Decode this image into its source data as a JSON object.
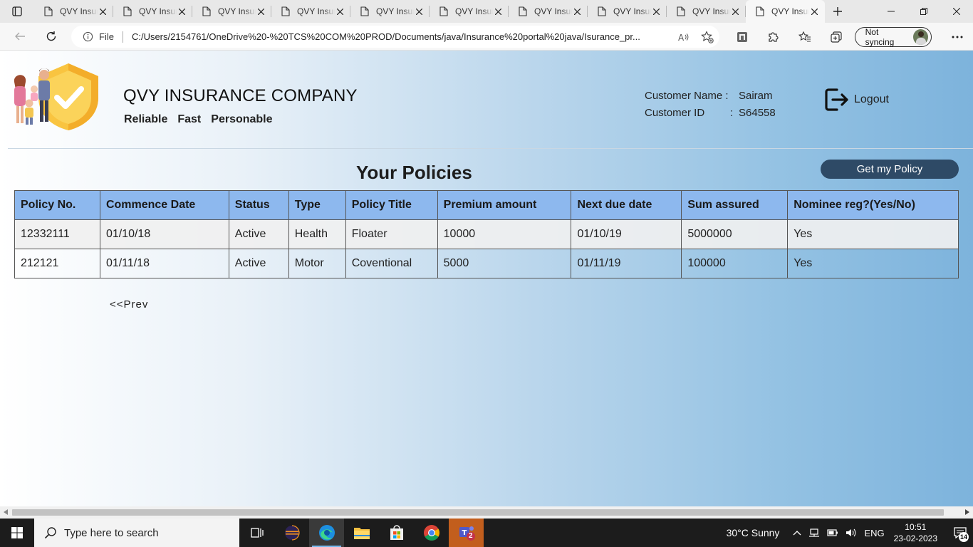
{
  "browser": {
    "tabs": [
      {
        "title": "QVY Insurance Company"
      },
      {
        "title": "QVY Insurance Company"
      },
      {
        "title": "QVY Insurance Company"
      },
      {
        "title": "QVY Insurance Company"
      },
      {
        "title": "QVY Insurance Company"
      },
      {
        "title": "QVY Insurance Company"
      },
      {
        "title": "QVY Insurance Company"
      },
      {
        "title": "QVY Insurance Company"
      },
      {
        "title": "QVY Insurance Company"
      },
      {
        "title": "QVY Insurance Company"
      }
    ],
    "address": {
      "scheme_label": "File",
      "url": "C:/Users/2154761/OneDrive%20-%20TCS%20COM%20PROD/Documents/java/Insurance%20portal%20java/Isurance_pr..."
    },
    "sync_label": "Not syncing"
  },
  "header": {
    "company_name": "QVY INSURANCE COMPANY",
    "tagline": [
      "Reliable",
      "Fast",
      "Personable"
    ],
    "customer": {
      "name_label": "Customer Name :",
      "name_value": "Sairam",
      "id_label": "Customer ID",
      "id_sep": ":",
      "id_value": "S64558"
    },
    "logout_label": "Logout"
  },
  "main": {
    "title": "Your Policies",
    "get_policy_label": "Get my Policy",
    "table": {
      "columns": [
        "Policy No.",
        "Commence Date",
        "Status",
        "Type",
        "Policy Title",
        "Premium amount",
        "Next due date",
        "Sum assured",
        "Nominee reg?(Yes/No)"
      ],
      "rows": [
        [
          "12332111",
          "01/10/18",
          "Active",
          "Health",
          "Floater",
          "10000",
          "01/10/19",
          "5000000",
          "Yes"
        ],
        [
          "212121",
          "01/11/18",
          "Active",
          "Motor",
          "Coventional",
          "5000",
          "01/11/19",
          "100000",
          "Yes"
        ]
      ]
    },
    "prev_label": "<<Prev"
  },
  "taskbar": {
    "search_placeholder": "Type here to search",
    "weather": "30°C  Sunny",
    "language": "ENG",
    "time": "10:51",
    "date": "23-02-2023",
    "notification_count": "14",
    "teams_badge": "2"
  },
  "colors": {
    "table_header": "#8db8ee",
    "get_policy_button": "#2e4a66",
    "taskbar": "#1c1c1c"
  }
}
